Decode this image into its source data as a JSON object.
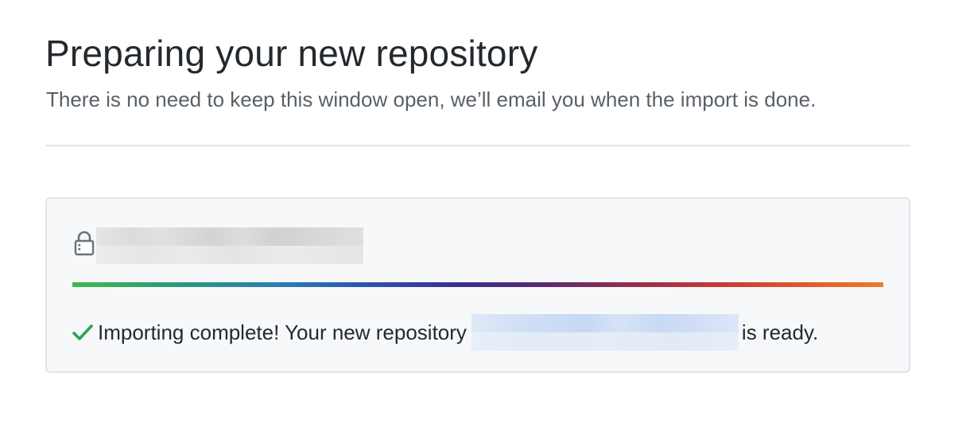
{
  "header": {
    "title": "Preparing your new repository",
    "subtitle": "There is no need to keep this window open, we’ll email you when the import is done."
  },
  "import_panel": {
    "repo_icon": "lock-icon",
    "progress_percent": 100,
    "status_icon": "check-icon",
    "status_prefix": "Importing complete! Your new repository",
    "status_suffix": "is ready."
  },
  "colors": {
    "check": "#2da44e",
    "progress_start": "#3fb950",
    "progress_end": "#ef7a2a",
    "panel_bg": "#f6f8fa",
    "border": "#e1e4e8"
  }
}
